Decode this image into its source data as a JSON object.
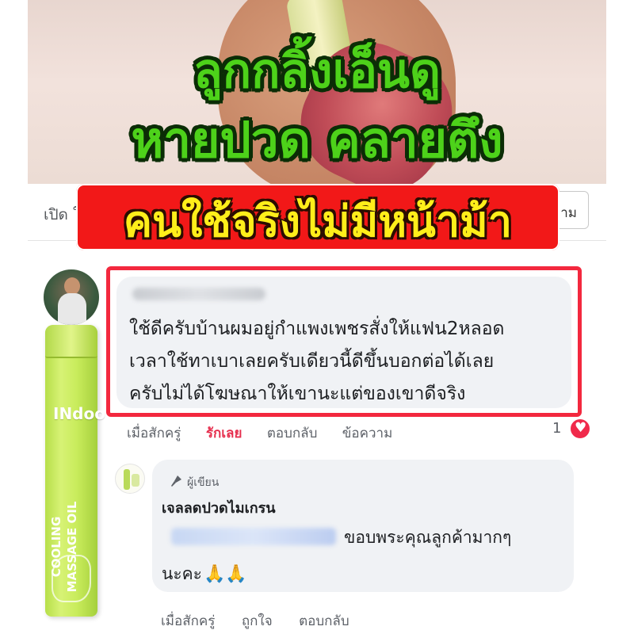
{
  "headline": {
    "line1": "ลูกกลิ้งเอ็นดู",
    "line2": "หายปวด คลายตึง"
  },
  "red_banner": "คนใช้จริงไม่มีหน้าม้า",
  "fb_bar": {
    "open_text": "เปิด ใ",
    "message_button_label": "ความ"
  },
  "comment": {
    "text_lines": [
      "ใช้ดีครับบ้านผมอยู่กำแพงเพชรสั่งให้แฟน2หลอด",
      "เวลาใช้ทาเบาเลยครับเดียวนี้ดีขึ้นบอกต่อได้เลย",
      "ครับไม่ได้โฆษณาให้เขานะแต่ของเขาดีจริง"
    ],
    "actions": {
      "time": "เมื่อสักครู่",
      "reaction": "รักเลย",
      "reply": "ตอบกลับ",
      "message": "ข้อความ"
    },
    "reaction_count": "1"
  },
  "product": {
    "brand": "INdoo",
    "label_line1": "COOLING",
    "label_line2": "MASSAGE OIL"
  },
  "reply": {
    "author_badge": "ผู้เขียน",
    "page_name": "เจลลดปวดไมเกรน",
    "line1": "ขอบพระคุณลูกค้ามากๆ",
    "line2": "นะคะ",
    "emoji": "🙏🙏",
    "actions": {
      "time": "เมื่อสักครู่",
      "like": "ถูกใจ",
      "reply": "ตอบกลับ"
    }
  }
}
